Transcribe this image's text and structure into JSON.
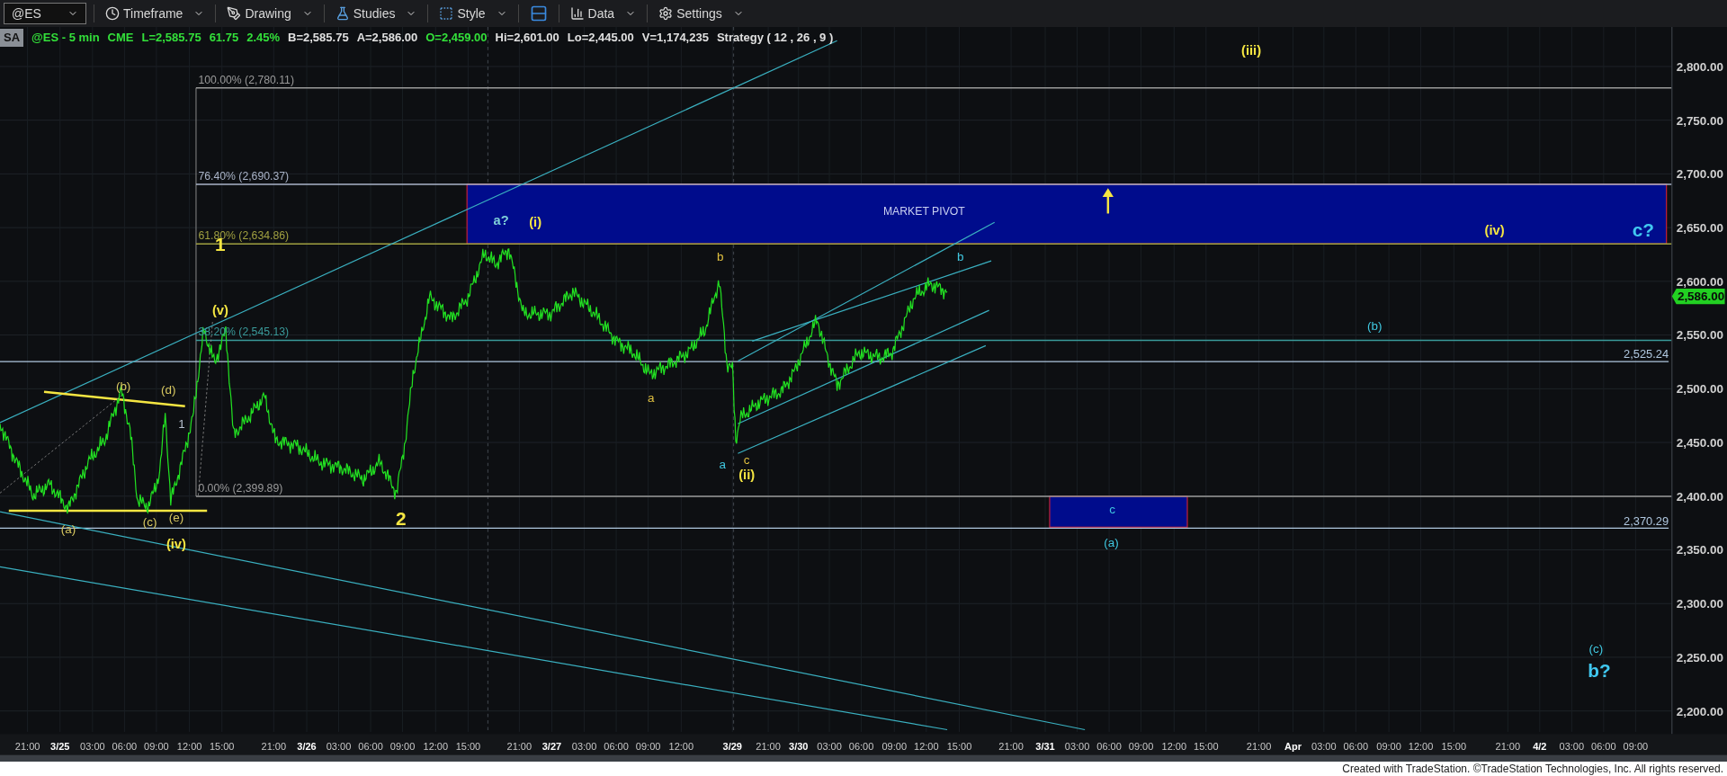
{
  "toolbar": {
    "symbol": "@ES",
    "menus": [
      {
        "label": "Timeframe",
        "kind": "clock"
      },
      {
        "label": "Drawing",
        "kind": "pen"
      },
      {
        "label": "Studies",
        "kind": "flask"
      },
      {
        "label": "Style",
        "kind": "style"
      },
      {
        "kind": "layout"
      },
      {
        "label": "Data",
        "kind": "data"
      },
      {
        "label": "Settings",
        "kind": "gear"
      }
    ]
  },
  "info_bar": {
    "tag": "SA",
    "items": [
      {
        "text": "@ES - 5 min",
        "color": "#33e03a"
      },
      {
        "text": "CME",
        "color": "#33e03a"
      },
      {
        "text": "L=2,585.75",
        "color": "#33e03a"
      },
      {
        "text": "61.75",
        "color": "#33e03a"
      },
      {
        "text": "2.45%",
        "color": "#33e03a"
      },
      {
        "text": "B=2,585.75",
        "color": "#e0e0e0"
      },
      {
        "text": "A=2,586.00",
        "color": "#e0e0e0"
      },
      {
        "text": "O=2,459.00",
        "color": "#33e03a"
      },
      {
        "text": "Hi=2,601.00",
        "color": "#e0e0e0"
      },
      {
        "text": "Lo=2,445.00",
        "color": "#e0e0e0"
      },
      {
        "text": "V=1,174,235",
        "color": "#e0e0e0"
      },
      {
        "text": "Strategy ( 12 , 26 , 9 )",
        "color": "#e0e0e0"
      }
    ]
  },
  "chart": {
    "fib_levels": [
      {
        "label": "100.00% (2,780.11)"
      },
      {
        "label": "76.40% (2,690.37)"
      },
      {
        "label": "61.80% (2,634.86)"
      },
      {
        "label": "38.20% (2,545.13)"
      },
      {
        "label": "0.00% (2,399.89)"
      }
    ],
    "levels": [
      "2,525.24",
      "2,370.29"
    ],
    "zone_label": "MARKET PIVOT",
    "wave_labels": [
      {
        "text": "1",
        "color": "#f5e642",
        "kind": "major"
      },
      {
        "text": "(v)",
        "color": "#f5e642",
        "kind": "bold"
      },
      {
        "text": "(b)",
        "color": "#d8c860",
        "kind": "minor"
      },
      {
        "text": "(d)",
        "color": "#d8c860",
        "kind": "minor"
      },
      {
        "text": "1",
        "color": "#b8c0d0",
        "kind": "minor"
      },
      {
        "text": "(a)",
        "color": "#d8c860",
        "kind": "minor"
      },
      {
        "text": "(c)",
        "color": "#d8c860",
        "kind": "minor"
      },
      {
        "text": "(e)",
        "color": "#d8c860",
        "kind": "minor"
      },
      {
        "text": "(iv)",
        "color": "#f5e642",
        "kind": "bold"
      },
      {
        "text": "2",
        "color": "#f5e642",
        "kind": "major"
      },
      {
        "text": "a?",
        "color": "#7ecfd8",
        "kind": "bold"
      },
      {
        "text": "(i)",
        "color": "#f5e642",
        "kind": "bold"
      },
      {
        "text": "b",
        "color": "#e0c040",
        "kind": "minor"
      },
      {
        "text": "a",
        "color": "#e0c040",
        "kind": "minor"
      },
      {
        "text": "a",
        "color": "#40c8e0",
        "kind": "minor"
      },
      {
        "text": "c",
        "color": "#e0c040",
        "kind": "minor"
      },
      {
        "text": "(ii)",
        "color": "#f5e642",
        "kind": "bold"
      },
      {
        "text": "b",
        "color": "#40c8e0",
        "kind": "minor"
      },
      {
        "text": "(iii)",
        "color": "#f5e642",
        "kind": "bold"
      },
      {
        "text": "(iv)",
        "color": "#f5e642",
        "kind": "bold"
      },
      {
        "text": "c?",
        "color": "#40c8f0",
        "kind": "major"
      },
      {
        "text": "(b)",
        "color": "#40c8e0",
        "kind": "minor"
      },
      {
        "text": "c",
        "color": "#40c8e0",
        "kind": "minor"
      },
      {
        "text": "(a)",
        "color": "#40c8e0",
        "kind": "minor"
      },
      {
        "text": "(c)",
        "color": "#40c8e0",
        "kind": "minor"
      },
      {
        "text": "b?",
        "color": "#40c8f0",
        "kind": "major"
      }
    ],
    "price_axis": [
      "2,800.00",
      "2,750.00",
      "2,700.00",
      "2,650.00",
      "2,600.00",
      "2,550.00",
      "2,500.00",
      "2,450.00",
      "2,400.00",
      "2,350.00",
      "2,300.00",
      "2,250.00",
      "2,200.00"
    ],
    "current_price": "2,586.00",
    "time_axis": [
      {
        "text": "21:00",
        "kind": "time"
      },
      {
        "text": "3/25",
        "kind": "date"
      },
      {
        "text": "03:00",
        "kind": "time"
      },
      {
        "text": "06:00",
        "kind": "time"
      },
      {
        "text": "09:00",
        "kind": "time"
      },
      {
        "text": "12:00",
        "kind": "time"
      },
      {
        "text": "15:00",
        "kind": "time"
      },
      {
        "text": "21:00",
        "kind": "time"
      },
      {
        "text": "3/26",
        "kind": "date"
      },
      {
        "text": "03:00",
        "kind": "time"
      },
      {
        "text": "06:00",
        "kind": "time"
      },
      {
        "text": "09:00",
        "kind": "time"
      },
      {
        "text": "12:00",
        "kind": "time"
      },
      {
        "text": "15:00",
        "kind": "time"
      },
      {
        "text": "21:00",
        "kind": "time"
      },
      {
        "text": "3/27",
        "kind": "date"
      },
      {
        "text": "03:00",
        "kind": "time"
      },
      {
        "text": "06:00",
        "kind": "time"
      },
      {
        "text": "09:00",
        "kind": "time"
      },
      {
        "text": "12:00",
        "kind": "time"
      },
      {
        "text": "3/29",
        "kind": "date"
      },
      {
        "text": "21:00",
        "kind": "time"
      },
      {
        "text": "3/30",
        "kind": "date"
      },
      {
        "text": "03:00",
        "kind": "time"
      },
      {
        "text": "06:00",
        "kind": "time"
      },
      {
        "text": "09:00",
        "kind": "time"
      },
      {
        "text": "12:00",
        "kind": "time"
      },
      {
        "text": "15:00",
        "kind": "time"
      },
      {
        "text": "21:00",
        "kind": "time"
      },
      {
        "text": "3/31",
        "kind": "date"
      },
      {
        "text": "03:00",
        "kind": "time"
      },
      {
        "text": "06:00",
        "kind": "time"
      },
      {
        "text": "09:00",
        "kind": "time"
      },
      {
        "text": "12:00",
        "kind": "time"
      },
      {
        "text": "15:00",
        "kind": "time"
      },
      {
        "text": "21:00",
        "kind": "time"
      },
      {
        "text": "Apr",
        "kind": "date"
      },
      {
        "text": "03:00",
        "kind": "time"
      },
      {
        "text": "06:00",
        "kind": "time"
      },
      {
        "text": "09:00",
        "kind": "time"
      },
      {
        "text": "12:00",
        "kind": "time"
      },
      {
        "text": "15:00",
        "kind": "time"
      },
      {
        "text": "21:00",
        "kind": "time"
      },
      {
        "text": "4/2",
        "kind": "date"
      },
      {
        "text": "03:00",
        "kind": "time"
      },
      {
        "text": "06:00",
        "kind": "time"
      },
      {
        "text": "09:00",
        "kind": "time"
      }
    ]
  },
  "footer": "Created with TradeStation. ©TradeStation Technologies, Inc. All rights reserved."
}
